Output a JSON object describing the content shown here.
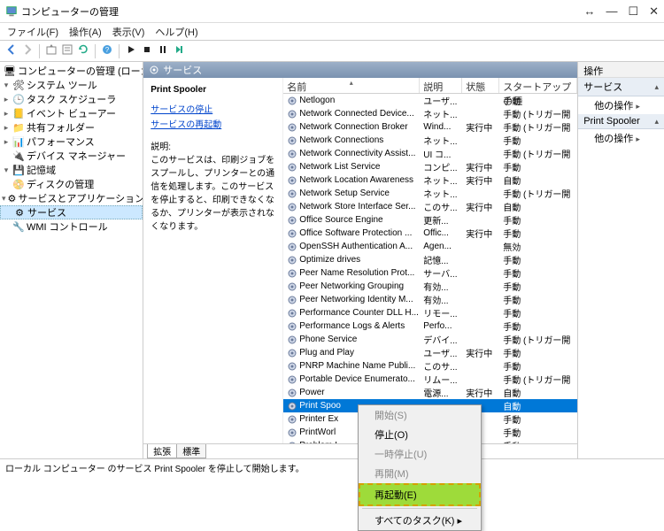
{
  "window": {
    "title": "コンピューターの管理",
    "min": "—",
    "max": "☐",
    "close": "✕",
    "extra": "↔"
  },
  "menu": [
    "ファイル(F)",
    "操作(A)",
    "表示(V)",
    "ヘルプ(H)"
  ],
  "tree": [
    {
      "lvl": 0,
      "exp": "",
      "icon": "computer",
      "label": "コンピューターの管理 (ローカル)"
    },
    {
      "lvl": 1,
      "exp": "v",
      "icon": "tools",
      "label": "システム ツール"
    },
    {
      "lvl": 2,
      "exp": ">",
      "icon": "task",
      "label": "タスク スケジューラ"
    },
    {
      "lvl": 2,
      "exp": ">",
      "icon": "event",
      "label": "イベント ビューアー"
    },
    {
      "lvl": 2,
      "exp": ">",
      "icon": "shared",
      "label": "共有フォルダー"
    },
    {
      "lvl": 2,
      "exp": ">",
      "icon": "perf",
      "label": "パフォーマンス"
    },
    {
      "lvl": 2,
      "exp": "",
      "icon": "device",
      "label": "デバイス マネージャー"
    },
    {
      "lvl": 1,
      "exp": "v",
      "icon": "storage",
      "label": "記憶域"
    },
    {
      "lvl": 2,
      "exp": "",
      "icon": "disk",
      "label": "ディスクの管理"
    },
    {
      "lvl": 1,
      "exp": "v",
      "icon": "services",
      "label": "サービスとアプリケーション"
    },
    {
      "lvl": 2,
      "exp": "",
      "icon": "gear",
      "label": "サービス",
      "sel": true
    },
    {
      "lvl": 2,
      "exp": "",
      "icon": "wmi",
      "label": "WMI コントロール"
    }
  ],
  "center_title": "サービス",
  "detail": {
    "service_name": "Print Spooler",
    "link_stop": "サービスの停止",
    "link_restart": "サービスの再起動",
    "label_desc": "説明:",
    "desc": "このサービスは、印刷ジョブをスプールし、プリンターとの通信を処理します。このサービスを停止すると、印刷できなくなるか、プリンターが表示されなくなります。"
  },
  "columns": {
    "name": "名前",
    "desc": "説明",
    "status": "状態",
    "startup": "スタートアップの種"
  },
  "services": [
    {
      "n": "Netlogon",
      "d": "ユーザ...",
      "s": "",
      "t": "手動"
    },
    {
      "n": "Network Connected Device...",
      "d": "ネット...",
      "s": "",
      "t": "手動 (トリガー開"
    },
    {
      "n": "Network Connection Broker",
      "d": "Wind...",
      "s": "実行中",
      "t": "手動 (トリガー開"
    },
    {
      "n": "Network Connections",
      "d": "ネット...",
      "s": "",
      "t": "手動"
    },
    {
      "n": "Network Connectivity Assist...",
      "d": "UI コ...",
      "s": "",
      "t": "手動 (トリガー開"
    },
    {
      "n": "Network List Service",
      "d": "コンピ...",
      "s": "実行中",
      "t": "手動"
    },
    {
      "n": "Network Location Awareness",
      "d": "ネット...",
      "s": "実行中",
      "t": "自動"
    },
    {
      "n": "Network Setup Service",
      "d": "ネット...",
      "s": "",
      "t": "手動 (トリガー開"
    },
    {
      "n": "Network Store Interface Ser...",
      "d": "このサ...",
      "s": "実行中",
      "t": "自動"
    },
    {
      "n": "Office  Source Engine",
      "d": "更新...",
      "s": "",
      "t": "手動"
    },
    {
      "n": "Office Software Protection ...",
      "d": "Offic...",
      "s": "実行中",
      "t": "手動"
    },
    {
      "n": "OpenSSH Authentication A...",
      "d": "Agen...",
      "s": "",
      "t": "無効"
    },
    {
      "n": "Optimize drives",
      "d": "記憶...",
      "s": "",
      "t": "手動"
    },
    {
      "n": "Peer Name Resolution Prot...",
      "d": "サーバ...",
      "s": "",
      "t": "手動"
    },
    {
      "n": "Peer Networking Grouping",
      "d": "有効...",
      "s": "",
      "t": "手動"
    },
    {
      "n": "Peer Networking Identity M...",
      "d": "有効...",
      "s": "",
      "t": "手動"
    },
    {
      "n": "Performance Counter DLL H...",
      "d": "リモー...",
      "s": "",
      "t": "手動"
    },
    {
      "n": "Performance Logs & Alerts",
      "d": "Perfo...",
      "s": "",
      "t": "手動"
    },
    {
      "n": "Phone Service",
      "d": "デバイ...",
      "s": "",
      "t": "手動 (トリガー開"
    },
    {
      "n": "Plug and Play",
      "d": "ユーザ...",
      "s": "実行中",
      "t": "手動"
    },
    {
      "n": "PNRP Machine Name Publi...",
      "d": "このサ...",
      "s": "",
      "t": "手動"
    },
    {
      "n": "Portable Device Enumerato...",
      "d": "リムー...",
      "s": "",
      "t": "手動 (トリガー開"
    },
    {
      "n": "Power",
      "d": "電源...",
      "s": "実行中",
      "t": "自動"
    },
    {
      "n": "Print Spoo",
      "d": "",
      "s": "",
      "t": "自動",
      "sel": true
    },
    {
      "n": "Printer Ex",
      "d": "",
      "s": "",
      "t": "手動"
    },
    {
      "n": "PrintWorl",
      "d": "",
      "s": "",
      "t": "手動"
    },
    {
      "n": "Problem I",
      "d": "",
      "s": "",
      "t": "手動"
    }
  ],
  "tabs": {
    "extended": "拡張",
    "standard": "標準"
  },
  "context_menu": [
    {
      "label": "開始(S)",
      "enabled": false
    },
    {
      "label": "停止(O)",
      "enabled": true
    },
    {
      "label": "一時停止(U)",
      "enabled": false
    },
    {
      "label": "再開(M)",
      "enabled": false
    },
    {
      "label": "再起動(E)",
      "enabled": true,
      "highlight": true
    },
    {
      "sep": true
    },
    {
      "label": "すべてのタスク(K)",
      "enabled": true,
      "sub": true
    }
  ],
  "right": {
    "title": "操作",
    "section1": "サービス",
    "item1": "他の操作",
    "section2": "Print Spooler",
    "item2": "他の操作"
  },
  "status": "ローカル コンピューター のサービス Print Spooler を停止して開始します。"
}
